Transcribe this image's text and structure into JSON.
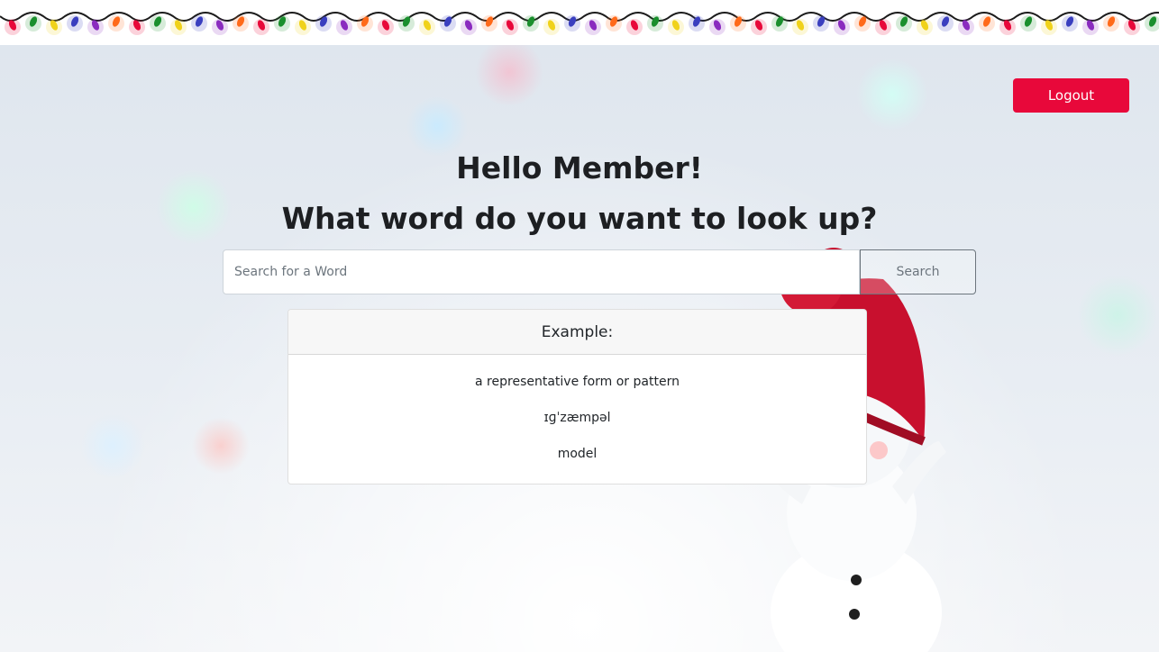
{
  "header": {
    "logout_label": "Logout"
  },
  "hero": {
    "greeting": "Hello Member!",
    "prompt": "What word do you want to look up?"
  },
  "search": {
    "placeholder": "Search for a Word",
    "value": "",
    "button_label": "Search"
  },
  "example": {
    "title": "Example:",
    "definition": "a representative form or pattern",
    "pronunciation": "ɪɡˈzæmpəl",
    "synonym": "model"
  },
  "colors": {
    "logout_bg": "#e8083a",
    "light_colors": [
      "#e8083a",
      "#1a8f2d",
      "#f0d21a",
      "#3a3fbf",
      "#8a2bbf",
      "#ff6a1a"
    ]
  },
  "icons": {
    "banner": "string-lights",
    "background": "snowman-scene"
  }
}
